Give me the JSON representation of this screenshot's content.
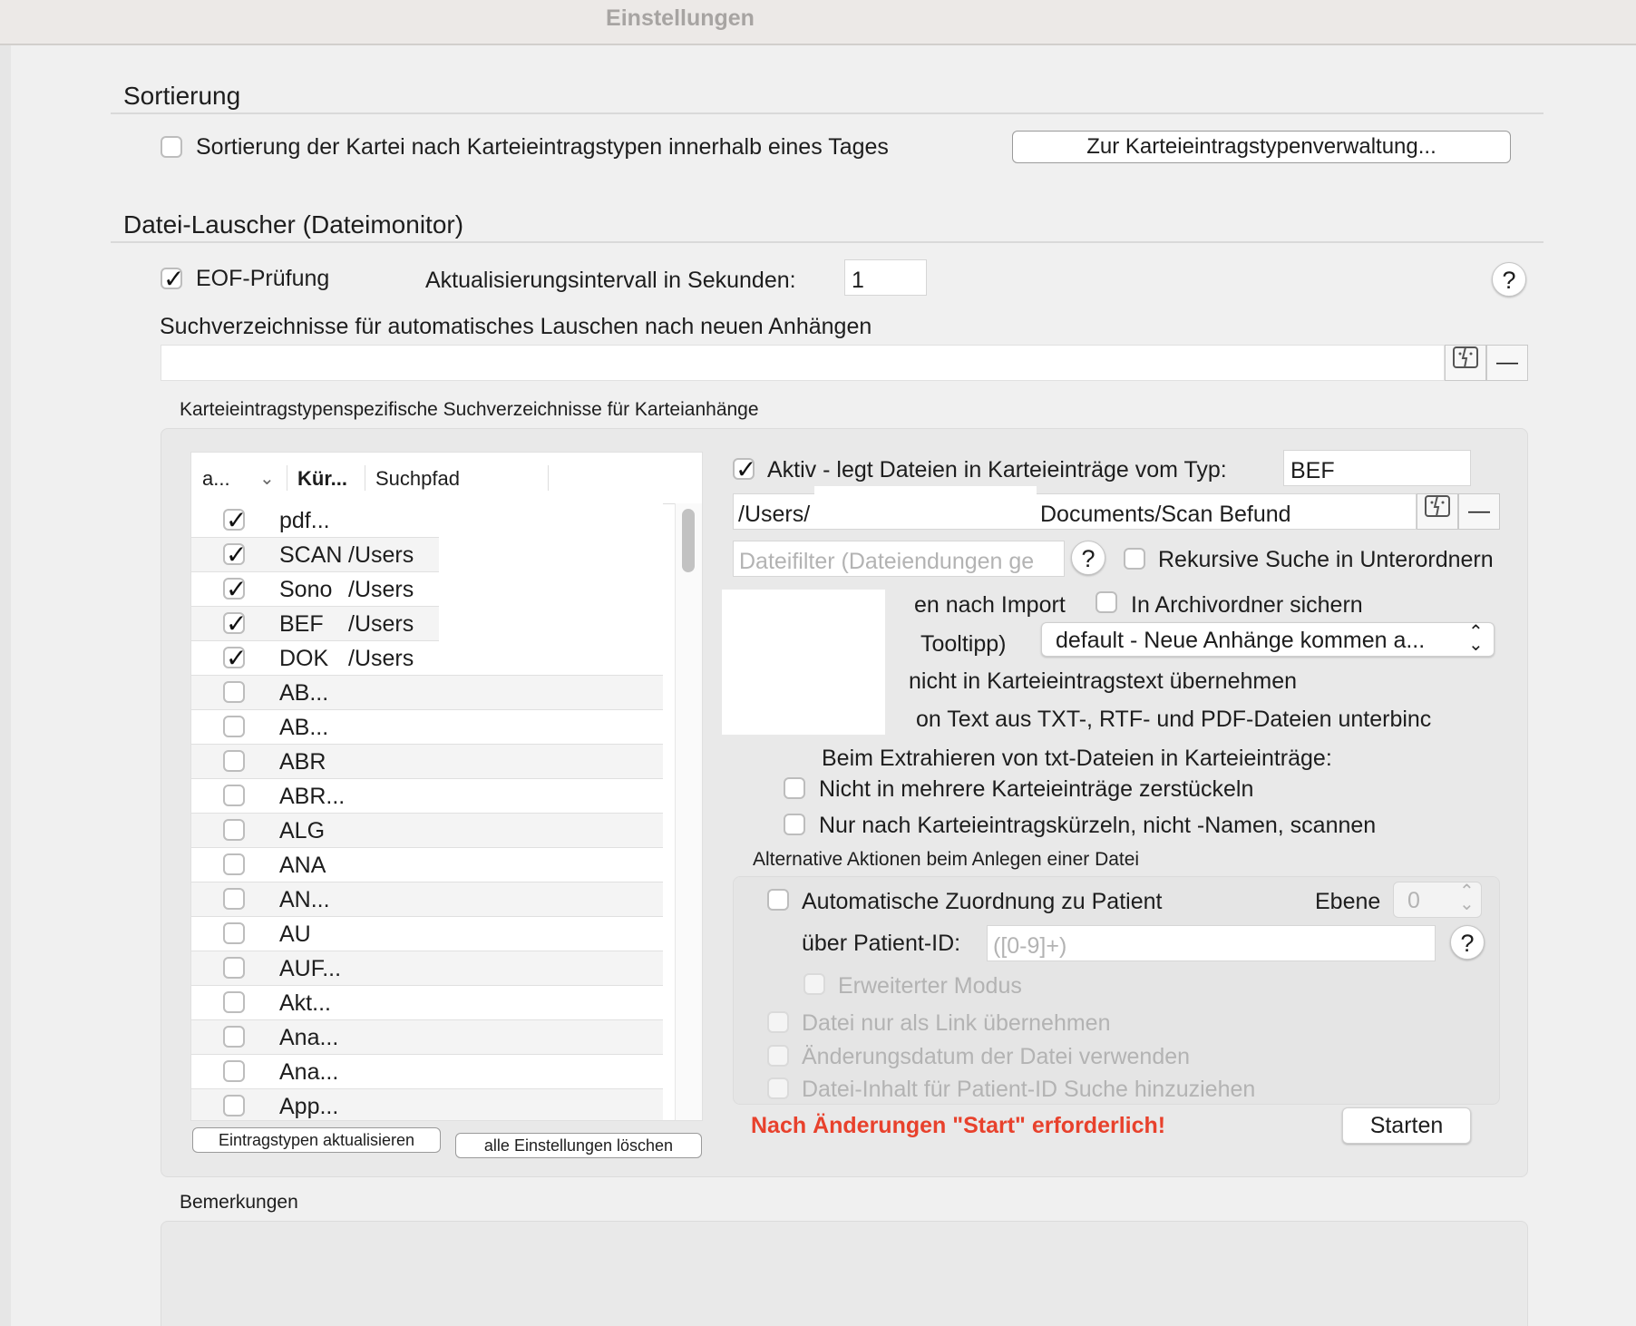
{
  "window": {
    "title": "Einstellungen"
  },
  "sortierung": {
    "header": "Sortierung",
    "checkbox_label": "Sortierung der Kartei nach Karteieintragstypen innerhalb eines Tages",
    "checked": false,
    "button_label": "Zur Karteieintragstypenverwaltung..."
  },
  "lauscher": {
    "header": "Datei-Lauscher (Dateimonitor)",
    "eof_label": "EOF-Prüfung",
    "eof_checked": true,
    "interval_label": "Aktualisierungsintervall in Sekunden:",
    "interval_value": "1",
    "help": "?",
    "suchverz_label": "Suchverzeichnisse für automatisches Lauschen nach neuen Anhängen",
    "remove_glyph": "—"
  },
  "spezifisch": {
    "title": "Karteieintragstypenspezifische Suchverzeichnisse für Karteianhänge",
    "table": {
      "col_a": "a...",
      "col_kuerzel": "Kür...",
      "col_suchpfad": "Suchpfad",
      "rows": [
        {
          "checked": true,
          "kuerzel": "pdf...",
          "pfad": ""
        },
        {
          "checked": true,
          "kuerzel": "SCAN",
          "pfad": "/Users"
        },
        {
          "checked": true,
          "kuerzel": "Sono",
          "pfad": "/Users"
        },
        {
          "checked": true,
          "kuerzel": "BEF",
          "pfad": "/Users"
        },
        {
          "checked": true,
          "kuerzel": "DOK",
          "pfad": "/Users"
        },
        {
          "checked": false,
          "kuerzel": "AB...",
          "pfad": ""
        },
        {
          "checked": false,
          "kuerzel": "AB...",
          "pfad": ""
        },
        {
          "checked": false,
          "kuerzel": "ABR",
          "pfad": ""
        },
        {
          "checked": false,
          "kuerzel": "ABR...",
          "pfad": ""
        },
        {
          "checked": false,
          "kuerzel": "ALG",
          "pfad": ""
        },
        {
          "checked": false,
          "kuerzel": "ANA",
          "pfad": ""
        },
        {
          "checked": false,
          "kuerzel": "AN...",
          "pfad": ""
        },
        {
          "checked": false,
          "kuerzel": "AU",
          "pfad": ""
        },
        {
          "checked": false,
          "kuerzel": "AUF...",
          "pfad": ""
        },
        {
          "checked": false,
          "kuerzel": "Akt...",
          "pfad": ""
        },
        {
          "checked": false,
          "kuerzel": "Ana...",
          "pfad": ""
        },
        {
          "checked": false,
          "kuerzel": "Ana...",
          "pfad": ""
        },
        {
          "checked": false,
          "kuerzel": "App...",
          "pfad": ""
        }
      ]
    },
    "btn_update": "Eintragstypen aktualisieren",
    "btn_delete": "alle Einstellungen löschen",
    "aktiv_label": "Aktiv - legt Dateien in Karteieinträge vom Typ:",
    "aktiv_checked": true,
    "typ_value": "BEF",
    "pfad_prefix": "/Users/",
    "pfad_suffix": "Documents/Scan Befund",
    "filter_placeholder": "Dateifilter (Dateiendungen ge",
    "rekursiv_label": "Rekursive Suche in Unterordnern",
    "import_partial": "en nach Import",
    "archiv_label": "In Archivordner sichern",
    "tooltipp_partial": "Tooltipp)",
    "select_value": "default - Neue Anhänge kommen a...",
    "nicht_partial": "nicht in Karteieintragstext übernehmen",
    "text_partial": "on Text aus TXT-, RTF- und PDF-Dateien unterbinc",
    "extrahieren_label": "Beim Extrahieren von txt-Dateien in Karteieinträge:",
    "zerstueckeln_label": "Nicht in mehrere Karteieinträge zerstückeln",
    "scannen_label": "Nur nach Karteieintragskürzeln, nicht -Namen, scannen",
    "alt_title": "Alternative Aktionen beim Anlegen einer Datei",
    "auto_label": "Automatische Zuordnung zu Patient",
    "ebene_label": "Ebene",
    "ebene_value": "0",
    "patient_id_label": "über Patient-ID:",
    "patient_id_placeholder": "([0-9]+)",
    "erweitert_label": "Erweiterter Modus",
    "link_label": "Datei nur als Link übernehmen",
    "datum_label": "Änderungsdatum der Datei verwenden",
    "inhalt_label": "Datei-Inhalt für Patient-ID Suche hinzuziehen",
    "warning": "Nach Änderungen \"Start\" erforderlich!",
    "start_label": "Starten"
  },
  "bemerkungen": {
    "title": "Bemerkungen"
  },
  "colors": {
    "warning": "#e8412c",
    "disabled_text": "#b3b3b3"
  }
}
